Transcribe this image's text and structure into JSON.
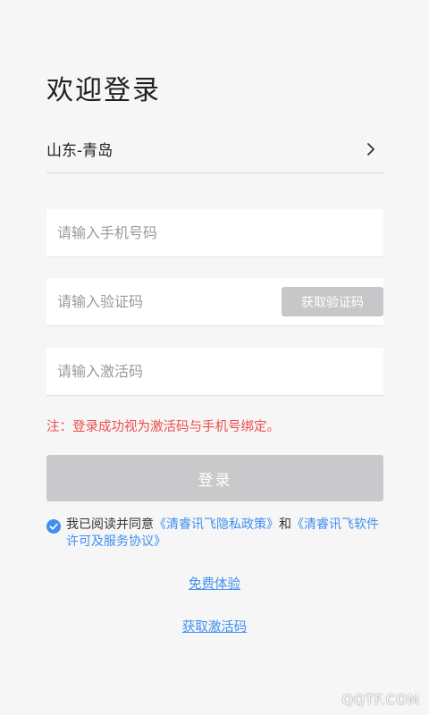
{
  "title": "欢迎登录",
  "region": {
    "value": "山东-青岛"
  },
  "fields": {
    "phone_placeholder": "请输入手机号码",
    "code_placeholder": "请输入验证码",
    "activation_placeholder": "请输入激活码"
  },
  "get_code_label": "获取验证码",
  "note": "注：登录成功视为激活码与手机号绑定。",
  "login_label": "登录",
  "agreement": {
    "prefix": "我已阅读并同意",
    "privacy_link": "《清睿讯飞隐私政策》",
    "and": "和",
    "license_link": "《清睿讯飞软件许可及服务协议》",
    "checked": true
  },
  "free_trial_label": "免费体验",
  "get_activation_label": "获取激活码",
  "watermark": "QQTF.COM",
  "colors": {
    "accent": "#3f8ff0",
    "warning": "#ef4d4d",
    "disabled_button": "#c9c9cb"
  }
}
